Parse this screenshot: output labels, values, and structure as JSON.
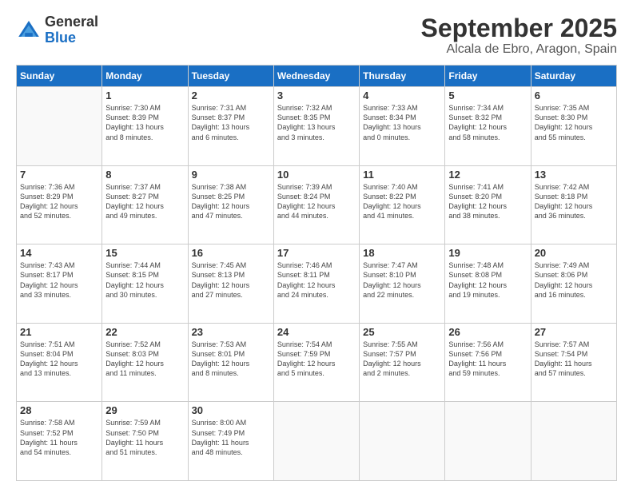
{
  "header": {
    "logo_general": "General",
    "logo_blue": "Blue",
    "title": "September 2025",
    "subtitle": "Alcala de Ebro, Aragon, Spain"
  },
  "columns": [
    "Sunday",
    "Monday",
    "Tuesday",
    "Wednesday",
    "Thursday",
    "Friday",
    "Saturday"
  ],
  "weeks": [
    {
      "days": [
        {
          "num": "",
          "info": ""
        },
        {
          "num": "1",
          "info": "Sunrise: 7:30 AM\nSunset: 8:39 PM\nDaylight: 13 hours\nand 8 minutes."
        },
        {
          "num": "2",
          "info": "Sunrise: 7:31 AM\nSunset: 8:37 PM\nDaylight: 13 hours\nand 6 minutes."
        },
        {
          "num": "3",
          "info": "Sunrise: 7:32 AM\nSunset: 8:35 PM\nDaylight: 13 hours\nand 3 minutes."
        },
        {
          "num": "4",
          "info": "Sunrise: 7:33 AM\nSunset: 8:34 PM\nDaylight: 13 hours\nand 0 minutes."
        },
        {
          "num": "5",
          "info": "Sunrise: 7:34 AM\nSunset: 8:32 PM\nDaylight: 12 hours\nand 58 minutes."
        },
        {
          "num": "6",
          "info": "Sunrise: 7:35 AM\nSunset: 8:30 PM\nDaylight: 12 hours\nand 55 minutes."
        }
      ]
    },
    {
      "days": [
        {
          "num": "7",
          "info": "Sunrise: 7:36 AM\nSunset: 8:29 PM\nDaylight: 12 hours\nand 52 minutes."
        },
        {
          "num": "8",
          "info": "Sunrise: 7:37 AM\nSunset: 8:27 PM\nDaylight: 12 hours\nand 49 minutes."
        },
        {
          "num": "9",
          "info": "Sunrise: 7:38 AM\nSunset: 8:25 PM\nDaylight: 12 hours\nand 47 minutes."
        },
        {
          "num": "10",
          "info": "Sunrise: 7:39 AM\nSunset: 8:24 PM\nDaylight: 12 hours\nand 44 minutes."
        },
        {
          "num": "11",
          "info": "Sunrise: 7:40 AM\nSunset: 8:22 PM\nDaylight: 12 hours\nand 41 minutes."
        },
        {
          "num": "12",
          "info": "Sunrise: 7:41 AM\nSunset: 8:20 PM\nDaylight: 12 hours\nand 38 minutes."
        },
        {
          "num": "13",
          "info": "Sunrise: 7:42 AM\nSunset: 8:18 PM\nDaylight: 12 hours\nand 36 minutes."
        }
      ]
    },
    {
      "days": [
        {
          "num": "14",
          "info": "Sunrise: 7:43 AM\nSunset: 8:17 PM\nDaylight: 12 hours\nand 33 minutes."
        },
        {
          "num": "15",
          "info": "Sunrise: 7:44 AM\nSunset: 8:15 PM\nDaylight: 12 hours\nand 30 minutes."
        },
        {
          "num": "16",
          "info": "Sunrise: 7:45 AM\nSunset: 8:13 PM\nDaylight: 12 hours\nand 27 minutes."
        },
        {
          "num": "17",
          "info": "Sunrise: 7:46 AM\nSunset: 8:11 PM\nDaylight: 12 hours\nand 24 minutes."
        },
        {
          "num": "18",
          "info": "Sunrise: 7:47 AM\nSunset: 8:10 PM\nDaylight: 12 hours\nand 22 minutes."
        },
        {
          "num": "19",
          "info": "Sunrise: 7:48 AM\nSunset: 8:08 PM\nDaylight: 12 hours\nand 19 minutes."
        },
        {
          "num": "20",
          "info": "Sunrise: 7:49 AM\nSunset: 8:06 PM\nDaylight: 12 hours\nand 16 minutes."
        }
      ]
    },
    {
      "days": [
        {
          "num": "21",
          "info": "Sunrise: 7:51 AM\nSunset: 8:04 PM\nDaylight: 12 hours\nand 13 minutes."
        },
        {
          "num": "22",
          "info": "Sunrise: 7:52 AM\nSunset: 8:03 PM\nDaylight: 12 hours\nand 11 minutes."
        },
        {
          "num": "23",
          "info": "Sunrise: 7:53 AM\nSunset: 8:01 PM\nDaylight: 12 hours\nand 8 minutes."
        },
        {
          "num": "24",
          "info": "Sunrise: 7:54 AM\nSunset: 7:59 PM\nDaylight: 12 hours\nand 5 minutes."
        },
        {
          "num": "25",
          "info": "Sunrise: 7:55 AM\nSunset: 7:57 PM\nDaylight: 12 hours\nand 2 minutes."
        },
        {
          "num": "26",
          "info": "Sunrise: 7:56 AM\nSunset: 7:56 PM\nDaylight: 11 hours\nand 59 minutes."
        },
        {
          "num": "27",
          "info": "Sunrise: 7:57 AM\nSunset: 7:54 PM\nDaylight: 11 hours\nand 57 minutes."
        }
      ]
    },
    {
      "days": [
        {
          "num": "28",
          "info": "Sunrise: 7:58 AM\nSunset: 7:52 PM\nDaylight: 11 hours\nand 54 minutes."
        },
        {
          "num": "29",
          "info": "Sunrise: 7:59 AM\nSunset: 7:50 PM\nDaylight: 11 hours\nand 51 minutes."
        },
        {
          "num": "30",
          "info": "Sunrise: 8:00 AM\nSunset: 7:49 PM\nDaylight: 11 hours\nand 48 minutes."
        },
        {
          "num": "",
          "info": ""
        },
        {
          "num": "",
          "info": ""
        },
        {
          "num": "",
          "info": ""
        },
        {
          "num": "",
          "info": ""
        }
      ]
    }
  ]
}
